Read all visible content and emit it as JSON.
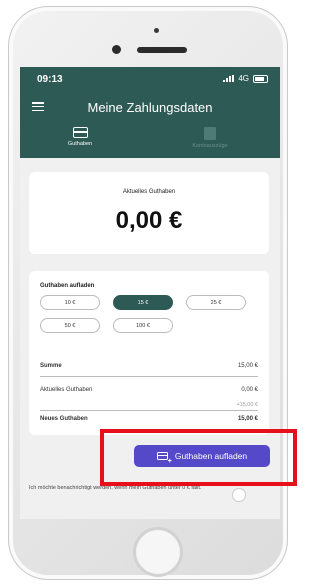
{
  "status_bar": {
    "time": "09:13",
    "network": "4G"
  },
  "header": {
    "title": "Meine Zahlungsdaten",
    "menu_icon": "hamburger-menu-icon"
  },
  "tabs": [
    {
      "label": "Guthaben",
      "icon": "credit-card-icon",
      "active": true
    },
    {
      "label": "Kontoauszüge",
      "icon": "documents-icon",
      "active": false
    }
  ],
  "balance": {
    "label": "Aktuelles Guthaben",
    "value": "0,00 €"
  },
  "topup": {
    "title": "Guthaben aufladen",
    "amounts": [
      "10 €",
      "15 €",
      "25 €",
      "50 €",
      "100 €"
    ],
    "selected": "15 €"
  },
  "summary": {
    "sum_label": "Summe",
    "sum_value": "15,00 €",
    "current_label": "Aktuelles Guthaben",
    "current_value": "0,00 €",
    "plus_value": "+15,00 €",
    "new_label": "Neues Guthaben",
    "new_value": "15,00 €"
  },
  "cta": {
    "label": "Guthaben aufladen",
    "icon": "card-add-icon"
  },
  "notification": {
    "text": "Ich möchte benachrichtigt werden, wenn mein Guthaben unter 0 € fällt."
  },
  "colors": {
    "header": "#2d5a55",
    "accent": "#5549c9",
    "highlight": "#e5101a"
  }
}
